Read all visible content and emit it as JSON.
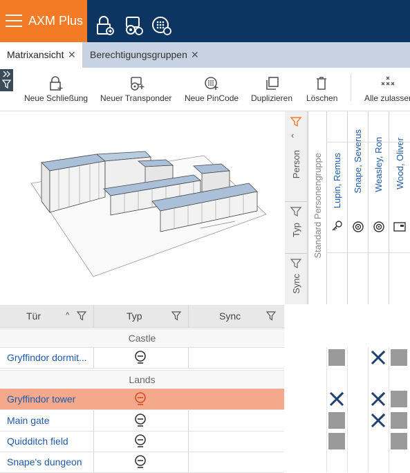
{
  "app": {
    "name": "AXM Plus"
  },
  "top_icons": [
    "lock-sync-icon",
    "transponder-sync-icon",
    "pincode-sync-icon"
  ],
  "tabs": [
    {
      "label": "Matrixansicht",
      "active": true
    },
    {
      "label": "Berechtigungsgruppen",
      "active": false
    }
  ],
  "toolbar": {
    "buttons": [
      {
        "label": "Neue Schließung",
        "icon": "new-lock-icon"
      },
      {
        "label": "Neuer Transponder",
        "icon": "new-transponder-icon"
      },
      {
        "label": "Neue PinCode",
        "icon": "new-pincode-icon"
      },
      {
        "label": "Duplizieren",
        "icon": "duplicate-icon"
      },
      {
        "label": "Löschen",
        "icon": "trash-icon"
      },
      {
        "label": "Alle zulassen",
        "icon": "allow-all-icon"
      }
    ]
  },
  "matrix": {
    "filters": {
      "person": "Person",
      "typ": "Typ",
      "sync": "Sync"
    },
    "group_column": "Standard Personengruppe",
    "persons": [
      {
        "name": "Lupin, Remus",
        "type_icon": "key-icon"
      },
      {
        "name": "Snape, Severus",
        "type_icon": "tag-icon"
      },
      {
        "name": "Weasley, Ron",
        "type_icon": "tag-icon"
      },
      {
        "name": "Wood, Oliver",
        "type_icon": "card-icon"
      }
    ]
  },
  "table": {
    "headers": {
      "door": "Tür",
      "type": "Typ",
      "sync": "Sync"
    },
    "groups": [
      {
        "label": "Castle",
        "rows": [
          {
            "name": "Gryffindor dormit...",
            "selected": false,
            "cells": [
              "granted",
              "none",
              "revoked",
              "granted"
            ]
          }
        ]
      },
      {
        "label": "Lands",
        "rows": [
          {
            "name": "Gryffindor tower",
            "selected": true,
            "cells": [
              "revoked",
              "none",
              "revoked",
              "granted"
            ]
          },
          {
            "name": "Main gate",
            "selected": false,
            "cells": [
              "granted",
              "none",
              "revoked",
              "granted"
            ]
          },
          {
            "name": "Quidditch field",
            "selected": false,
            "cells": [
              "granted",
              "none",
              "none",
              "granted"
            ]
          },
          {
            "name": "Snape's dungeon",
            "selected": false,
            "cells": [
              "none",
              "none",
              "none",
              "none"
            ]
          }
        ]
      }
    ]
  },
  "colors": {
    "brand": "#f47b26",
    "nav": "#0d3561",
    "selected_row": "#f5a98c",
    "link": "#1e5aa8",
    "granted": "#9a9a9a",
    "revoked": "#1e3f6f"
  }
}
